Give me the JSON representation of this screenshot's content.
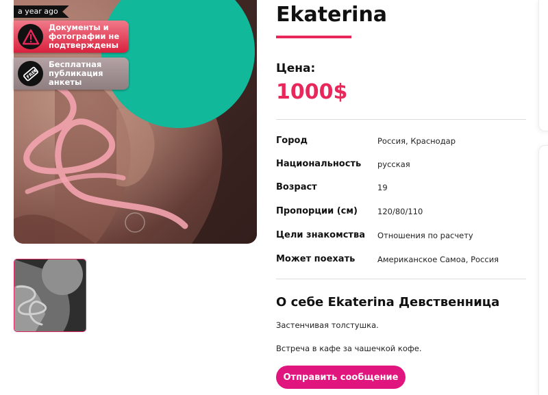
{
  "photo": {
    "time_ago": "a year ago",
    "badges": {
      "docs": {
        "text": "Документы и фотографии не подтверждены",
        "icon": "warning-icon"
      },
      "free": {
        "text": "Бесплатная публикация анкеты",
        "icon": "free-tag-icon"
      }
    },
    "thumbnail_count": 1
  },
  "profile": {
    "name": "Ekaterina",
    "price_label": "Цена:",
    "price_value": "1000$"
  },
  "details": [
    {
      "label": "Город",
      "value": "Россия, Краснодар"
    },
    {
      "label": "Национальность",
      "value": "русская"
    },
    {
      "label": "Возраст",
      "value": "19"
    },
    {
      "label": "Пропорции (см)",
      "value": "120/80/110"
    },
    {
      "label": "Цели знакомства",
      "value": "Отношения по расчету"
    },
    {
      "label": "Может поехать",
      "value": "Американское Самоа, Россия"
    }
  ],
  "about": {
    "title": "О себе Ekaterina Девственница",
    "paragraphs": [
      "Застенчивая толстушка.",
      "Встреча в кафе за чашечкой кофе."
    ]
  },
  "actions": {
    "send_message": "Отправить сообщение"
  },
  "colors": {
    "accent": "#e8275a",
    "button": "#e0157d",
    "censor": "#12b89a"
  }
}
